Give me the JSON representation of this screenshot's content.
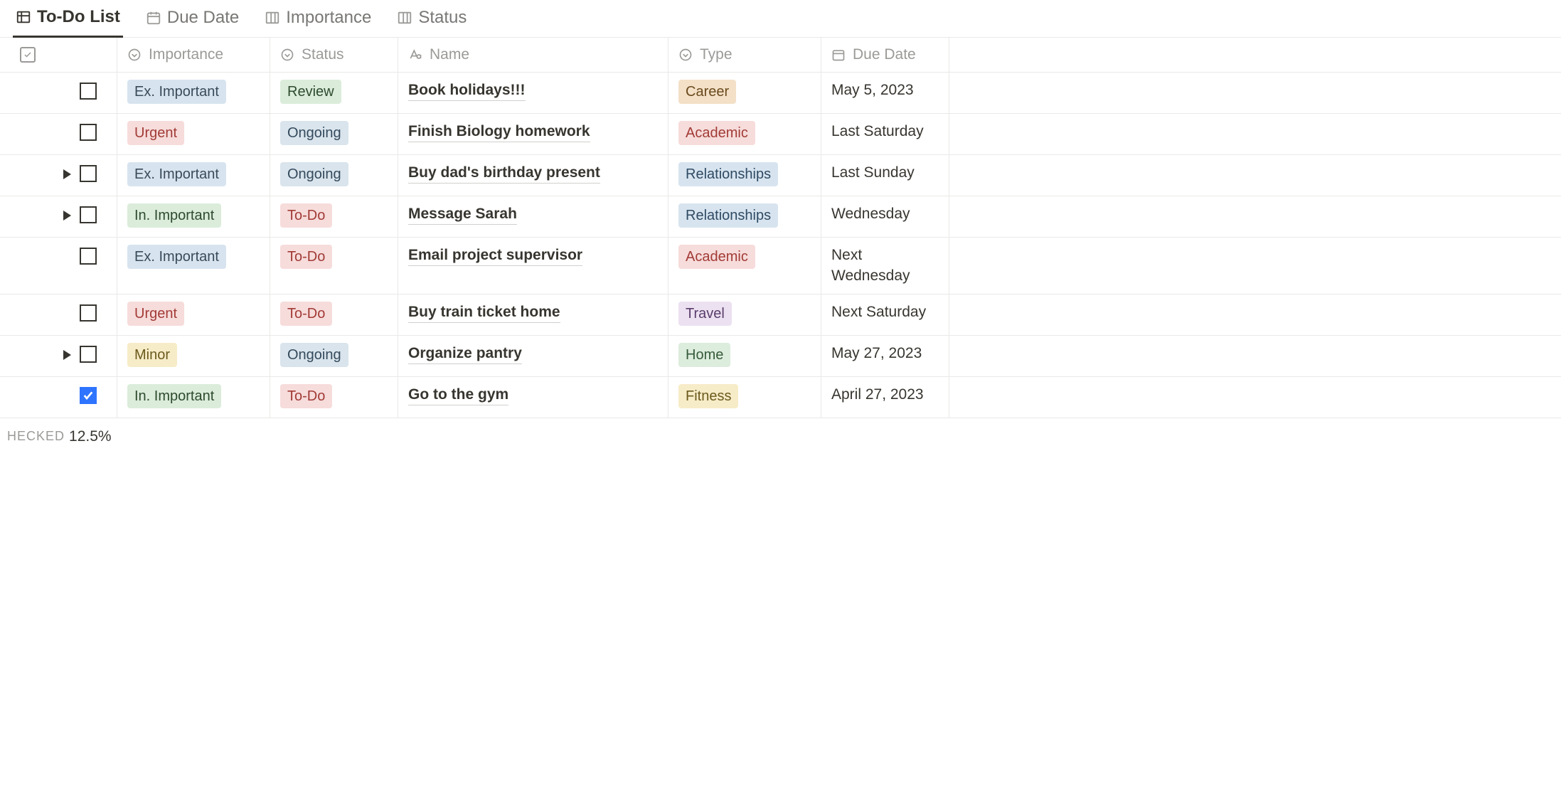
{
  "tabs": [
    {
      "label": "To-Do List",
      "icon": "table"
    },
    {
      "label": "Due Date",
      "icon": "calendar"
    },
    {
      "label": "Importance",
      "icon": "board"
    },
    {
      "label": "Status",
      "icon": "board"
    }
  ],
  "columns": {
    "checkbox": "",
    "importance": "Importance",
    "status": "Status",
    "name": "Name",
    "type": "Type",
    "due": "Due Date"
  },
  "rows": [
    {
      "toggle": false,
      "checked": false,
      "importance": {
        "text": "Ex. Important",
        "class": "c-lightblue"
      },
      "status": {
        "text": "Review",
        "class": "c-lightgreen"
      },
      "name": "Book holidays!!!",
      "type": {
        "text": "Career",
        "class": "c-orange"
      },
      "due": "May 5, 2023"
    },
    {
      "toggle": false,
      "checked": false,
      "importance": {
        "text": "Urgent",
        "class": "c-red-text"
      },
      "status": {
        "text": "Ongoing",
        "class": "c-bluegray"
      },
      "name": "Finish Biology homework",
      "type": {
        "text": "Academic",
        "class": "c-red-text"
      },
      "due": "Last Saturday"
    },
    {
      "toggle": true,
      "checked": false,
      "importance": {
        "text": "Ex. Important",
        "class": "c-lightblue"
      },
      "status": {
        "text": "Ongoing",
        "class": "c-bluegray"
      },
      "name": "Buy dad's birthday present",
      "type": {
        "text": "Relationships",
        "class": "c-blue-text"
      },
      "due": "Last Sunday"
    },
    {
      "toggle": true,
      "checked": false,
      "importance": {
        "text": "In. Important",
        "class": "c-lightgreen"
      },
      "status": {
        "text": "To-Do",
        "class": "c-red-text"
      },
      "name": "Message Sarah",
      "type": {
        "text": "Relationships",
        "class": "c-blue-text"
      },
      "due": "Wednesday"
    },
    {
      "toggle": false,
      "checked": false,
      "importance": {
        "text": "Ex. Important",
        "class": "c-lightblue"
      },
      "status": {
        "text": "To-Do",
        "class": "c-red-text"
      },
      "name": "Email project supervisor",
      "type": {
        "text": "Academic",
        "class": "c-red-text"
      },
      "due": "Next Wednesday"
    },
    {
      "toggle": false,
      "checked": false,
      "importance": {
        "text": "Urgent",
        "class": "c-red-text"
      },
      "status": {
        "text": "To-Do",
        "class": "c-red-text"
      },
      "name": "Buy train ticket home",
      "type": {
        "text": "Travel",
        "class": "c-purple"
      },
      "due": "Next Saturday"
    },
    {
      "toggle": true,
      "checked": false,
      "importance": {
        "text": "Minor",
        "class": "c-yellow"
      },
      "status": {
        "text": "Ongoing",
        "class": "c-bluegray"
      },
      "name": "Organize pantry",
      "type": {
        "text": "Home",
        "class": "c-greenbg"
      },
      "due": "May 27, 2023"
    },
    {
      "toggle": false,
      "checked": true,
      "importance": {
        "text": "In. Important",
        "class": "c-lightgreen"
      },
      "status": {
        "text": "To-Do",
        "class": "c-red-text"
      },
      "name": "Go to the gym",
      "type": {
        "text": "Fitness",
        "class": "c-yellow"
      },
      "due": "April 27, 2023"
    }
  ],
  "footer": {
    "label": "HECKED",
    "value": "12.5%"
  }
}
